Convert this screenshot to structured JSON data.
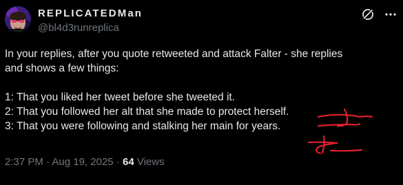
{
  "author": {
    "display_name": "REPLICATEDMan",
    "handle": "@bl4d3runreplica",
    "avatar_icon": "avatar-portrait"
  },
  "icons": {
    "grok": "grok-icon",
    "more": "more-options-icon"
  },
  "tweet": {
    "lines": [
      "In your replies, after you quote retweeted and attack Falter - she replies",
      "and shows a few things:",
      "",
      "1: That you liked her tweet before she tweeted it.",
      "2: That you followed her alt that she made to protect herself.",
      "3: That you were following and stalking her main for years."
    ]
  },
  "meta": {
    "time": "2:37 PM",
    "separator": "·",
    "date": "Aug 19, 2025",
    "views_count": "64",
    "views_label": "Views"
  },
  "colors": {
    "background": "#000000",
    "text": "#e7e9ea",
    "muted": "#71767b",
    "annotation": "#e0202a"
  }
}
